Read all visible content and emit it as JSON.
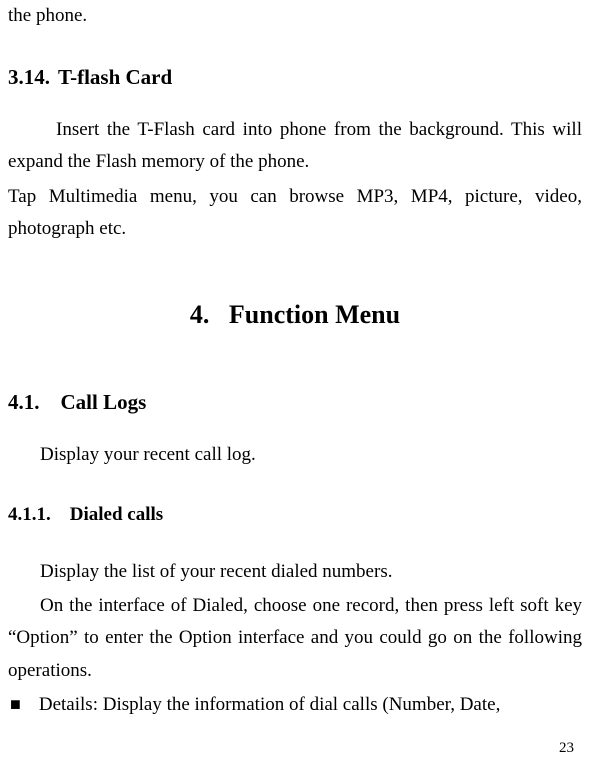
{
  "continuation_text": "the phone.",
  "sec_3_14": {
    "number": "3.14.",
    "title": "T-flash Card",
    "para1": "Insert the T-Flash card into phone from the background. This will expand the Flash memory of the phone.",
    "para2": "Tap Multimedia menu, you can browse MP3, MP4, picture, video, photograph etc."
  },
  "sec_4": {
    "number": "4.",
    "title": "Function Menu"
  },
  "sec_4_1": {
    "number": "4.1.",
    "title": "Call Logs",
    "para": "Display your recent call log."
  },
  "sec_4_1_1": {
    "number": "4.1.1.",
    "title": "Dialed calls",
    "para1": "Display the list of your recent dialed numbers.",
    "para2": "On the interface of Dialed, choose one record, then press left soft key “Option” to enter the Option interface and you could go on the following operations.",
    "bullet_symbol": "■",
    "bullet1": "Details: Display the information of dial calls (Number, Date,"
  },
  "page_number": "23"
}
